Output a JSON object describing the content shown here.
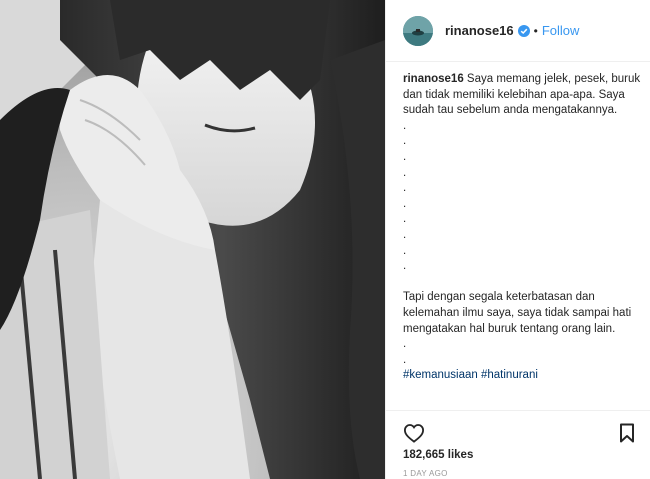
{
  "header": {
    "username": "rinanose16",
    "separator": "•",
    "follow_label": "Follow"
  },
  "caption": {
    "lines": [
      {
        "user": "rinanose16",
        "text": " Saya memang jelek, pesek, buruk"
      },
      {
        "text": "dan tidak memiliki kelebihan apa-apa. Saya"
      },
      {
        "text": "sudah tau sebelum anda mengatakannya."
      },
      {
        "text": "."
      },
      {
        "text": "."
      },
      {
        "text": "."
      },
      {
        "text": "."
      },
      {
        "text": "."
      },
      {
        "text": "."
      },
      {
        "text": "."
      },
      {
        "text": "."
      },
      {
        "text": "."
      },
      {
        "text": "."
      },
      {
        "text": ""
      },
      {
        "text": "Tapi dengan segala keterbatasan dan"
      },
      {
        "text": "kelemahan ilmu saya, saya tidak sampai hati"
      },
      {
        "text": "mengatakan hal buruk tentang orang lain."
      },
      {
        "text": "."
      },
      {
        "text": "."
      },
      {
        "text": "#kemanusiaan #hatinurani",
        "hashtag": true
      }
    ]
  },
  "footer": {
    "likes": "182,665 likes",
    "time": "1 DAY AGO"
  },
  "icons": {
    "verified": "verified-badge-icon",
    "like": "heart-icon",
    "save": "bookmark-icon"
  },
  "colors": {
    "accent": "#3897f0",
    "hashtag": "#003569",
    "text": "#262626",
    "muted": "#999999"
  }
}
